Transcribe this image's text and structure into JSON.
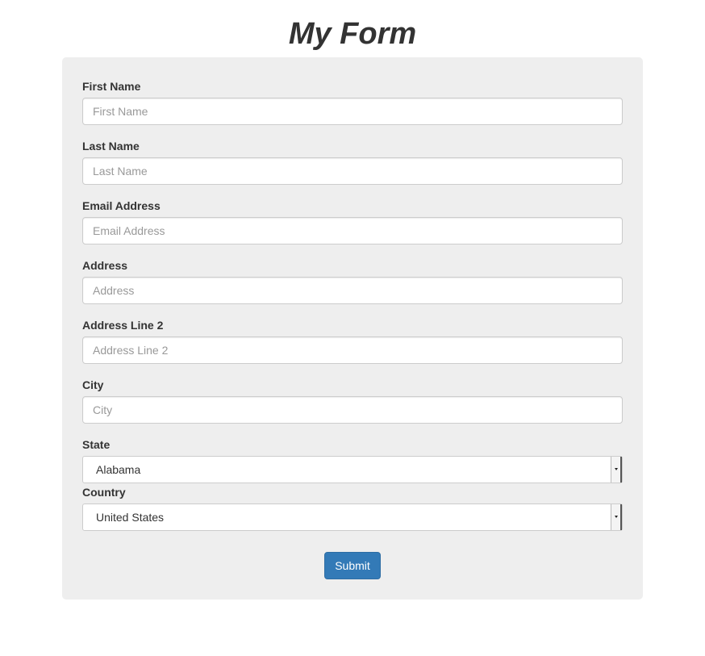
{
  "page": {
    "title": "My Form"
  },
  "form": {
    "fields": [
      {
        "label": "First Name",
        "placeholder": "First Name",
        "value": ""
      },
      {
        "label": "Last Name",
        "placeholder": "Last Name",
        "value": ""
      },
      {
        "label": "Email Address",
        "placeholder": "Email Address",
        "value": ""
      },
      {
        "label": "Address",
        "placeholder": "Address",
        "value": ""
      },
      {
        "label": "Address Line 2",
        "placeholder": "Address Line 2",
        "value": ""
      },
      {
        "label": "City",
        "placeholder": "City",
        "value": ""
      }
    ],
    "state": {
      "label": "State",
      "selected": "Alabama"
    },
    "country": {
      "label": "Country",
      "selected": "United States"
    },
    "submit_label": "Submit"
  },
  "colors": {
    "panel_background": "#eeeeee",
    "primary_button": "#337ab7",
    "label_text": "#333333",
    "placeholder_text": "#999999"
  }
}
